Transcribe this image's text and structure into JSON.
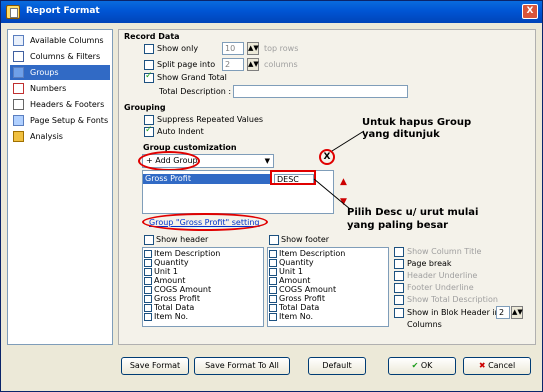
{
  "window": {
    "title": "Report Format",
    "close_glyph": "X"
  },
  "nav": {
    "items": [
      {
        "label": "Available Columns",
        "icon": "available-columns-icon"
      },
      {
        "label": "Columns & Filters",
        "icon": "columns-filters-icon"
      },
      {
        "label": "Groups",
        "icon": "groups-icon",
        "selected": true
      },
      {
        "label": "Numbers",
        "icon": "numbers-icon"
      },
      {
        "label": "Headers & Footers",
        "icon": "headers-footers-icon"
      },
      {
        "label": "Page Setup & Fonts",
        "icon": "page-setup-icon"
      },
      {
        "label": "Analysis",
        "icon": "analysis-icon"
      }
    ]
  },
  "record_data": {
    "heading": "Record Data",
    "show_only": {
      "label": "Show only",
      "value": "10",
      "unit": "top rows",
      "checked": false
    },
    "split_page": {
      "label": "Split page into",
      "value": "2",
      "unit": "columns",
      "checked": false
    },
    "show_grand_total": {
      "label": "Show Grand Total",
      "checked": true
    },
    "total_description": {
      "label": "Total Description :",
      "value": ""
    }
  },
  "grouping": {
    "heading": "Grouping",
    "suppress": {
      "label": "Suppress Repeated Values",
      "checked": false
    },
    "auto_indent": {
      "label": "Auto Indent",
      "checked": true
    }
  },
  "group_customization": {
    "heading": "Group customization",
    "add_group": "+ Add Group",
    "row_name": "Gross Profit",
    "row_order": "DESC",
    "setting_link": "Group \"Gross Profit\" setting"
  },
  "show_header": {
    "label": "Show header",
    "checked": false,
    "items": [
      "Item Description",
      "Quantity",
      "Unit 1",
      "Amount",
      "COGS Amount",
      "Gross Profit",
      "Total Data",
      "Item No."
    ]
  },
  "show_footer": {
    "label": "Show footer",
    "checked": false,
    "items": [
      "Item Description",
      "Quantity",
      "Unit 1",
      "Amount",
      "COGS Amount",
      "Gross Profit",
      "Total Data",
      "Item No."
    ]
  },
  "options": {
    "show_column_title": "Show Column Title",
    "page_break": "Page break",
    "header_underline": "Header Underline",
    "footer_underline": "Footer Underline",
    "show_total_description": "Show Total Description",
    "show_in_blok_header": "Show in Blok Header in",
    "blok_columns_value": "2",
    "columns_label": "Columns"
  },
  "annotations": {
    "remove_group": "Untuk hapus Group\nyang ditunjuk",
    "remove_marker": "X",
    "desc_note": "Pilih Desc u/ urut mulai\nyang paling besar"
  },
  "buttons": {
    "save_format": "Save Format",
    "save_format_all": "Save Format To All",
    "default": "Default",
    "ok": "OK",
    "cancel": "Cancel"
  },
  "colors": {
    "accent": "#316ac5",
    "annotation": "#e00000",
    "titlebar": "#0055d4"
  }
}
